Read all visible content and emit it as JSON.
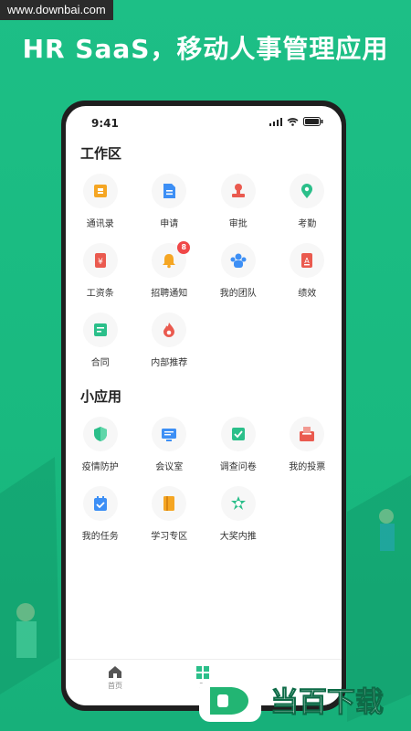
{
  "watermark_top": "www.downbai.com",
  "headline": "HR SaaS，移动人事管理应用",
  "status_time": "9:41",
  "sections": {
    "work_title": "工作区",
    "work_items": [
      "通讯录",
      "申请",
      "审批",
      "考勤",
      "工资条",
      "招聘通知",
      "我的团队",
      "绩效",
      "合同",
      "内部推荐"
    ],
    "recruit_badge": "8",
    "apps_title": "小应用",
    "app_items": [
      "疫情防护",
      "会议室",
      "调查问卷",
      "我的投票",
      "我的任务",
      "学习专区",
      "大奖内推"
    ]
  },
  "tabbar": {
    "home": "首页",
    "work": "工"
  },
  "logo_text": "当百下载",
  "colors": {
    "bg_green": "#1dbf86",
    "orange": "#f5a623",
    "blue": "#3d8ff5",
    "red": "#ea5a4f",
    "green": "#2bbf8a"
  },
  "icons": [
    "contacts-icon",
    "application-icon",
    "approval-icon",
    "attendance-icon",
    "payslip-icon",
    "bell-icon",
    "team-icon",
    "performance-icon",
    "contract-icon",
    "referral-icon",
    "shield-icon",
    "meeting-room-icon",
    "survey-icon",
    "vote-icon",
    "task-icon",
    "study-icon",
    "prize-icon",
    "home-icon",
    "work-icon"
  ]
}
